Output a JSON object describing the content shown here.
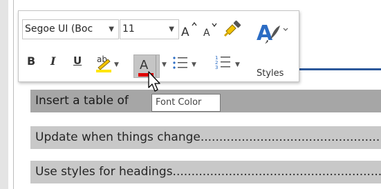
{
  "mini_toolbar": {
    "font_name": "Segoe UI (Boc",
    "font_size": "11",
    "bold_label": "B",
    "italic_label": "I",
    "underline_label": "U",
    "highlight_glyph": "ab",
    "font_color_letter": "A",
    "styles_label": "Styles",
    "font_color_bar": "#e00000",
    "highlight_bar": "#ffe600",
    "accent": "#2b579a"
  },
  "tooltip": {
    "text": "Font Color"
  },
  "document": {
    "lines": [
      {
        "text": "Insert a table of",
        "selected": true
      },
      {
        "text": "Update when things change......................................................................................"
      },
      {
        "text": "Use styles for headings..........................................................................................."
      }
    ]
  },
  "icons": [
    "grow-font-icon",
    "shrink-font-icon",
    "format-painter-icon",
    "styles-icon",
    "bullets-icon",
    "numbering-icon",
    "mouse-pointer-icon"
  ]
}
